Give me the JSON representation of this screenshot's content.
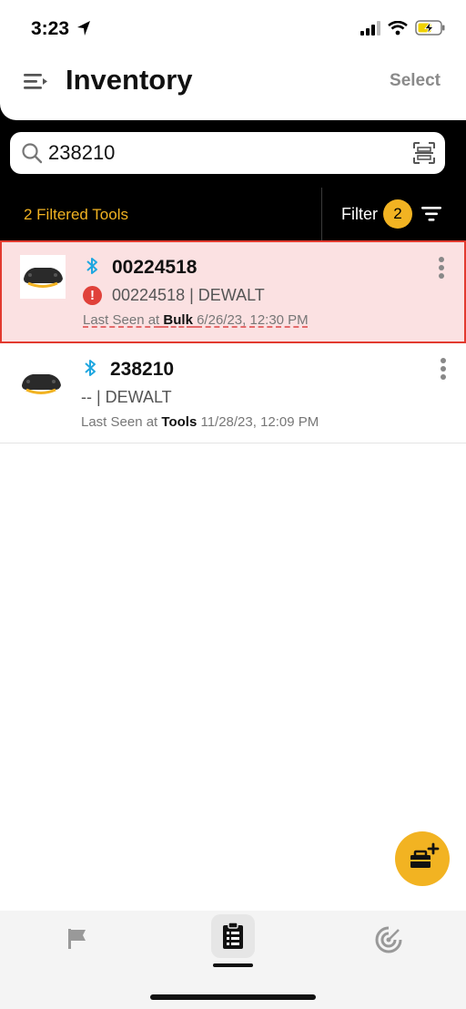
{
  "status_bar": {
    "time": "3:23"
  },
  "header": {
    "title": "Inventory",
    "select_label": "Select"
  },
  "search": {
    "value": "238210"
  },
  "filter_bar": {
    "count_text": "2 Filtered Tools",
    "filter_label": "Filter",
    "filter_count": "2"
  },
  "tools": [
    {
      "id": "00224518",
      "subtitle": "00224518 | DEWALT",
      "last_seen_prefix": "Last Seen at",
      "location": "Bulk",
      "timestamp": "6/26/23, 12:30 PM",
      "alert": true,
      "alert_glyph": "!"
    },
    {
      "id": "238210",
      "subtitle": "-- | DEWALT",
      "last_seen_prefix": "Last Seen at",
      "location": "Tools",
      "timestamp": "11/28/23, 12:09 PM",
      "alert": false
    }
  ],
  "colors": {
    "accent": "#f2b322",
    "alert": "#e23a2f",
    "bluetooth": "#1fa7e0"
  },
  "icons": [
    "location-arrow-icon",
    "signal-icon",
    "wifi-icon",
    "battery-charging-icon",
    "menu-icon",
    "search-icon",
    "scan-icon",
    "sort-icon",
    "bluetooth-icon",
    "alert-icon",
    "kebab-icon",
    "add-toolbox-icon",
    "flag-icon",
    "inventory-icon",
    "radar-icon"
  ]
}
